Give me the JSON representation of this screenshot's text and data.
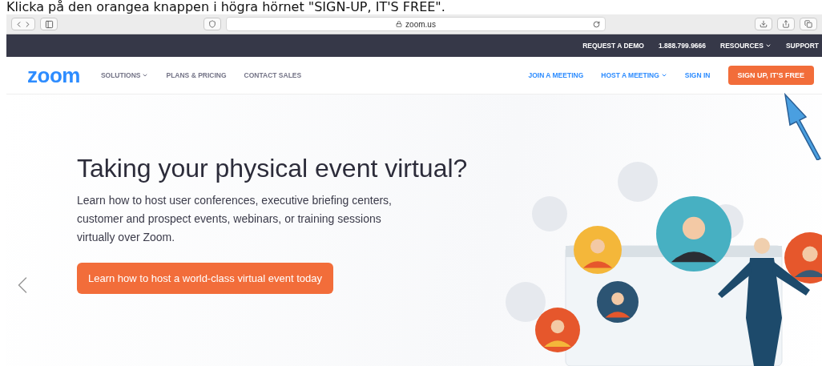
{
  "caption": "Klicka på den orangea knappen i högra hörnet \"SIGN-UP, IT'S FREE\".",
  "browser": {
    "address": "zoom.us"
  },
  "top_bar": {
    "items": [
      {
        "label": "REQUEST A DEMO",
        "dropdown": false
      },
      {
        "label": "1.888.799.9666",
        "dropdown": false
      },
      {
        "label": "RESOURCES",
        "dropdown": true
      },
      {
        "label": "SUPPORT",
        "dropdown": false
      }
    ]
  },
  "nav": {
    "logo": "zoom",
    "left": [
      {
        "label": "SOLUTIONS",
        "dropdown": true
      },
      {
        "label": "PLANS & PRICING",
        "dropdown": false
      },
      {
        "label": "CONTACT SALES",
        "dropdown": false
      }
    ],
    "right": [
      {
        "label": "JOIN A MEETING",
        "dropdown": false
      },
      {
        "label": "HOST A MEETING",
        "dropdown": true
      },
      {
        "label": "SIGN IN",
        "dropdown": false
      }
    ],
    "cta": "SIGN UP, IT'S FREE"
  },
  "hero": {
    "title": "Taking your physical event virtual?",
    "text": "Learn how to host user conferences, executive briefing centers, customer and prospect events, webinars, or training sessions virtually over Zoom.",
    "button": "Learn how to host a world-class virtual event today"
  }
}
